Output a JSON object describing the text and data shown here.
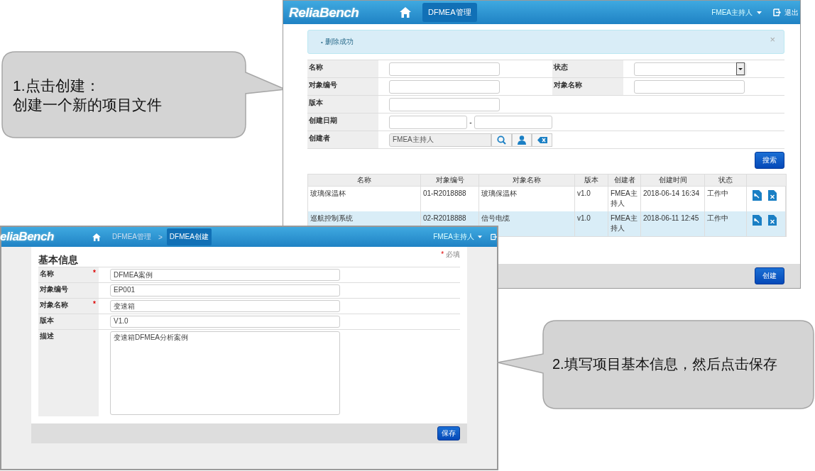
{
  "callouts": [
    {
      "lines": [
        "1.点击创建：",
        "创建一个新的项目文件"
      ]
    },
    {
      "lines": [
        "2.填写项目基本信息，然后点击保存"
      ]
    }
  ],
  "list_window": {
    "header": {
      "logo": "ReliaBench",
      "nav": [
        {
          "label": "DFMEA管理",
          "selected": true
        }
      ],
      "user": "FMEA主持人",
      "logout": "退出"
    },
    "alert": {
      "bullet": "•",
      "text": "删除成功",
      "close": "×"
    },
    "filters": [
      [
        {
          "label": "名称",
          "kind": "text"
        },
        {
          "label": "状态",
          "kind": "select"
        }
      ],
      [
        {
          "label": "对象编号",
          "kind": "text"
        },
        {
          "label": "对象名称",
          "kind": "text"
        }
      ],
      [
        {
          "label": "版本",
          "kind": "text"
        }
      ],
      [
        {
          "label": "创建日期",
          "kind": "date_range",
          "separator": "-"
        }
      ],
      [
        {
          "label": "创建者",
          "kind": "picker",
          "value": "FMEA主持人"
        }
      ]
    ],
    "search_button": "搜索",
    "table": {
      "columns": [
        "名称",
        "对象编号",
        "对象名称",
        "版本",
        "创建者",
        "创建时间",
        "状态"
      ],
      "rows": [
        {
          "selected": false,
          "cells": [
            "玻璃保温杯",
            "01-R2018888",
            "玻璃保温杯",
            "v1.0",
            "FMEA主持人",
            "2018-06-14 16:34",
            "工作中"
          ]
        },
        {
          "selected": true,
          "cells": [
            "巡航控制系统",
            "02-R2018888",
            "信号电缆",
            "v1.0",
            "FMEA主持人",
            "2018-06-11 12:45",
            "工作中"
          ]
        }
      ]
    },
    "create_button": "创建"
  },
  "create_window": {
    "header": {
      "logo": "eliaBench",
      "breadcrumb": [
        {
          "label": "DFMEA管理",
          "selected": false
        },
        {
          "label": "DFMEA创建",
          "selected": true
        }
      ],
      "separator": ">",
      "user": "FMEA主持人"
    },
    "title": "基本信息",
    "required_mark": "*",
    "required_note": "必填",
    "fields": [
      {
        "label": "名称",
        "required": true,
        "kind": "text",
        "value": "DFMEA案例"
      },
      {
        "label": "对象编号",
        "required": false,
        "kind": "text",
        "value": "EP001"
      },
      {
        "label": "对象名称",
        "required": true,
        "kind": "text",
        "value": "变速箱"
      },
      {
        "label": "版本",
        "required": false,
        "kind": "text",
        "value": "V1.0"
      },
      {
        "label": "描述",
        "required": false,
        "kind": "textarea",
        "value": "变速箱DFMEA分析案例"
      }
    ],
    "save_button": "保存"
  }
}
